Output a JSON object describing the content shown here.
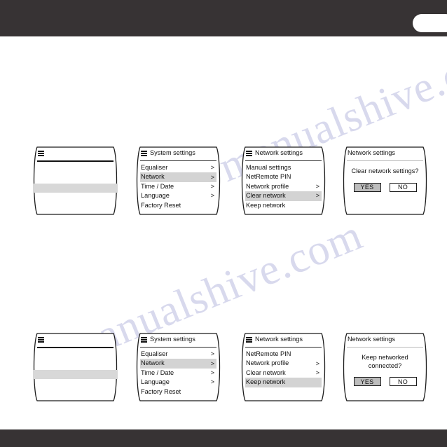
{
  "chrome": {
    "top_bar_color": "#373334",
    "bottom_bar_color": "#373334",
    "pill_color": "#ffffff"
  },
  "watermark": {
    "line_a": "manualshive.com",
    "line_b": "manualshive.com"
  },
  "theme": {
    "screen_bg": "#ffffff",
    "screen_border": "#1b1b1b",
    "highlight": "#d3d3d3",
    "button_active": "#bdbdbd",
    "text": "#111111"
  },
  "icons": {
    "hamburger": "menu-icon",
    "chevron": ">"
  },
  "flows": [
    {
      "name": "clear-network-flow",
      "screens": [
        {
          "kind": "blank",
          "id": "now-playing-blank-top",
          "has_hamburger": true,
          "title": "",
          "highlight_bar": true
        },
        {
          "kind": "menu",
          "id": "system-settings-top",
          "has_hamburger": true,
          "title": "System settings",
          "items": [
            {
              "label": "Equaliser",
              "chevron": ">",
              "selected": false
            },
            {
              "label": "Network",
              "chevron": ">",
              "selected": true
            },
            {
              "label": "Time / Date",
              "chevron": ">",
              "selected": false
            },
            {
              "label": "Language",
              "chevron": ">",
              "selected": false
            },
            {
              "label": "Factory Reset",
              "chevron": "",
              "selected": false
            }
          ]
        },
        {
          "kind": "menu",
          "id": "network-settings-top",
          "has_hamburger": true,
          "title": "Network settings",
          "items": [
            {
              "label": "Manual settings",
              "chevron": "",
              "selected": false
            },
            {
              "label": "NetRemote PIN",
              "chevron": "",
              "selected": false
            },
            {
              "label": "Network profile",
              "chevron": ">",
              "selected": false
            },
            {
              "label": "Clear network",
              "chevron": ">",
              "selected": true
            },
            {
              "label": "Keep network",
              "chevron": "",
              "selected": false
            }
          ]
        },
        {
          "kind": "dialog",
          "id": "clear-network-confirm",
          "has_hamburger": false,
          "title": "Network settings",
          "message_lines": [
            "Clear network settings?"
          ],
          "buttons": [
            {
              "label": "YES",
              "active": true
            },
            {
              "label": "NO",
              "active": false
            }
          ]
        }
      ]
    },
    {
      "name": "keep-network-flow",
      "screens": [
        {
          "kind": "blank",
          "id": "now-playing-blank-bottom",
          "has_hamburger": true,
          "title": "",
          "highlight_bar": true
        },
        {
          "kind": "menu",
          "id": "system-settings-bottom",
          "has_hamburger": true,
          "title": "System settings",
          "items": [
            {
              "label": "Equaliser",
              "chevron": ">",
              "selected": false
            },
            {
              "label": "Network",
              "chevron": ">",
              "selected": true
            },
            {
              "label": "Time / Date",
              "chevron": ">",
              "selected": false
            },
            {
              "label": "Language",
              "chevron": ">",
              "selected": false
            },
            {
              "label": "Factory Reset",
              "chevron": "",
              "selected": false
            }
          ]
        },
        {
          "kind": "menu",
          "id": "network-settings-bottom",
          "has_hamburger": true,
          "title": "Network settings",
          "items": [
            {
              "label": "NetRemote PIN",
              "chevron": "",
              "selected": false
            },
            {
              "label": "Network profile",
              "chevron": ">",
              "selected": false
            },
            {
              "label": "Clear network",
              "chevron": ">",
              "selected": false
            },
            {
              "label": "Keep network",
              "chevron": "",
              "selected": true
            }
          ]
        },
        {
          "kind": "dialog",
          "id": "keep-network-confirm",
          "has_hamburger": false,
          "title": "Network settings",
          "message_lines": [
            "Keep networked",
            "connected?"
          ],
          "buttons": [
            {
              "label": "YES",
              "active": true
            },
            {
              "label": "NO",
              "active": false
            }
          ]
        }
      ]
    }
  ]
}
